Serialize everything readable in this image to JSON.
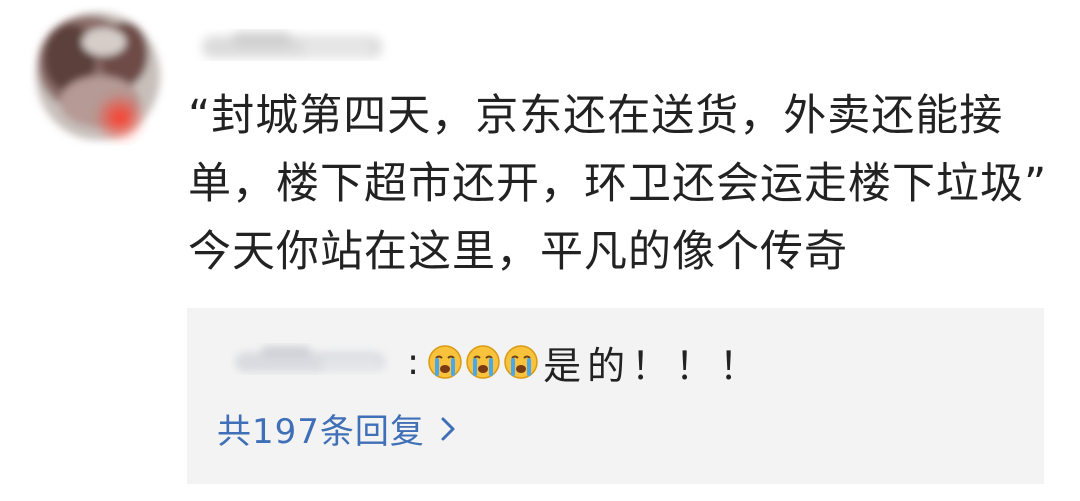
{
  "comment": {
    "text": "“封城第四天，京东还在送货，外卖还能接单，楼下超市还开，环卫还会运走楼下垃圾” 今天你站在这里，平凡的像个传奇"
  },
  "reply": {
    "separator": ":",
    "emoji": "crying-face-icon",
    "emoji_count": 3,
    "text": "是的！！！"
  },
  "more_replies": {
    "label": "共197条回复",
    "icon": "chevron-right-icon"
  },
  "colors": {
    "link": "#3f6fb6",
    "reply_bg": "#f3f3f3",
    "text": "#222222"
  }
}
